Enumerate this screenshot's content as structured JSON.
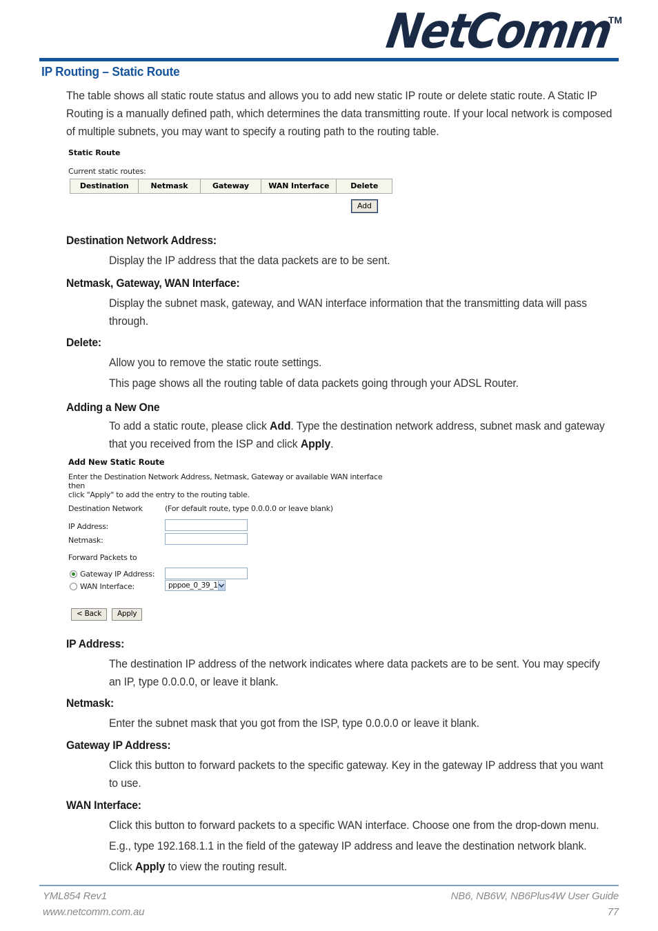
{
  "brand": {
    "logo_text": "NetComm",
    "trademark": "TM"
  },
  "page_title": "IP Routing – Static Route",
  "intro": "The table shows all static route status and allows you to add new static IP route or delete static route. A Static IP Routing is a manually defined path, which determines the data transmitting route. If your local network is composed of multiple subnets, you may want to specify a routing path to the routing table.",
  "static_route_screenshot": {
    "title": "Static Route",
    "current_routes_label": "Current static routes:",
    "columns": [
      "Destination",
      "Netmask",
      "Gateway",
      "WAN Interface",
      "Delete"
    ],
    "rows": [],
    "add_button": "Add"
  },
  "definitions": [
    {
      "term": "Destination Network Address:",
      "body": [
        "Display the IP address that the data packets are to be sent."
      ]
    },
    {
      "term": "Netmask, Gateway, WAN Interface:",
      "body": [
        "Display the subnet mask, gateway, and WAN interface information that the transmitting data will pass through."
      ]
    },
    {
      "term": "Delete:",
      "body": [
        "Allow you to remove the static route settings.",
        "This page shows all the routing table of data packets going through your ADSL Router."
      ]
    }
  ],
  "adding_section": {
    "term": "Adding a New One",
    "body_prefix": "To add a static route, please click ",
    "body_bold_1": "Add",
    "body_middle": ". Type the destination network address, subnet mask and gateway that you received from the ISP and click ",
    "body_bold_2": "Apply",
    "body_suffix": "."
  },
  "add_route_screenshot": {
    "title": "Add New Static Route",
    "intro_line_1": "Enter the Destination Network Address, Netmask, Gateway or available WAN interface then",
    "intro_line_2": "click \"Apply\" to add the entry to the routing table.",
    "destination_network_label": "Destination Network",
    "destination_network_hint": "(For default route, type 0.0.0.0 or leave blank)",
    "ip_address_label": "IP Address:",
    "ip_address_value": "",
    "netmask_label": "Netmask:",
    "netmask_value": "",
    "forward_packets_label": "Forward Packets to",
    "gateway_radio_label": "Gateway IP Address:",
    "gateway_radio_selected": true,
    "gateway_value": "",
    "wan_radio_label": "WAN Interface:",
    "wan_radio_selected": false,
    "wan_interface_selected": "pppoe_0_39_1",
    "back_button": "< Back",
    "apply_button": "Apply"
  },
  "definitions_2": [
    {
      "term": "IP Address:",
      "body": [
        "The destination IP address of the network indicates where data packets are to be sent. You may specify an IP, type 0.0.0.0, or leave it blank."
      ]
    },
    {
      "term": "Netmask:",
      "body": [
        "Enter the subnet mask that you got from the ISP, type 0.0.0.0 or leave it blank."
      ]
    },
    {
      "term": "Gateway IP Address:",
      "body": [
        "Click this button to forward packets to the specific gateway. Key in the gateway IP address that you want to use."
      ]
    },
    {
      "term": "WAN Interface:",
      "body": [
        "Click this button to forward packets to a specific WAN interface. Choose one from the drop-down menu.",
        "E.g., type 192.168.1.1 in the field of the gateway IP address and leave the destination network blank."
      ]
    }
  ],
  "closing": {
    "prefix": "Click ",
    "bold": "Apply",
    "suffix": " to view the routing result."
  },
  "footer": {
    "doc_ref": "YML854 Rev1",
    "website": "www.netcomm.com.au",
    "guide": "NB6, NB6W, NB6Plus4W User Guide",
    "page_number": "77"
  },
  "colors": {
    "brand_blue": "#15539c",
    "logo_navy": "#1b2a44",
    "body_text": "#343434",
    "footer_gray": "#8a8a8a",
    "table_header_bg": "#f6f5ec"
  }
}
